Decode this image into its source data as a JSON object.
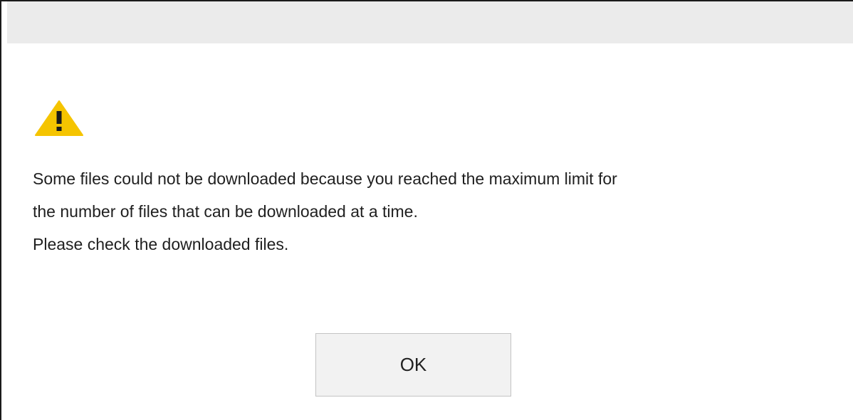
{
  "dialog": {
    "icon": "warning-icon",
    "icon_color": "#f5c400",
    "message_lines": [
      "Some files could not be downloaded because you reached the maximum limit for",
      "the number of files that can be downloaded at a time.",
      "Please check the downloaded files."
    ],
    "ok_label": "OK"
  }
}
